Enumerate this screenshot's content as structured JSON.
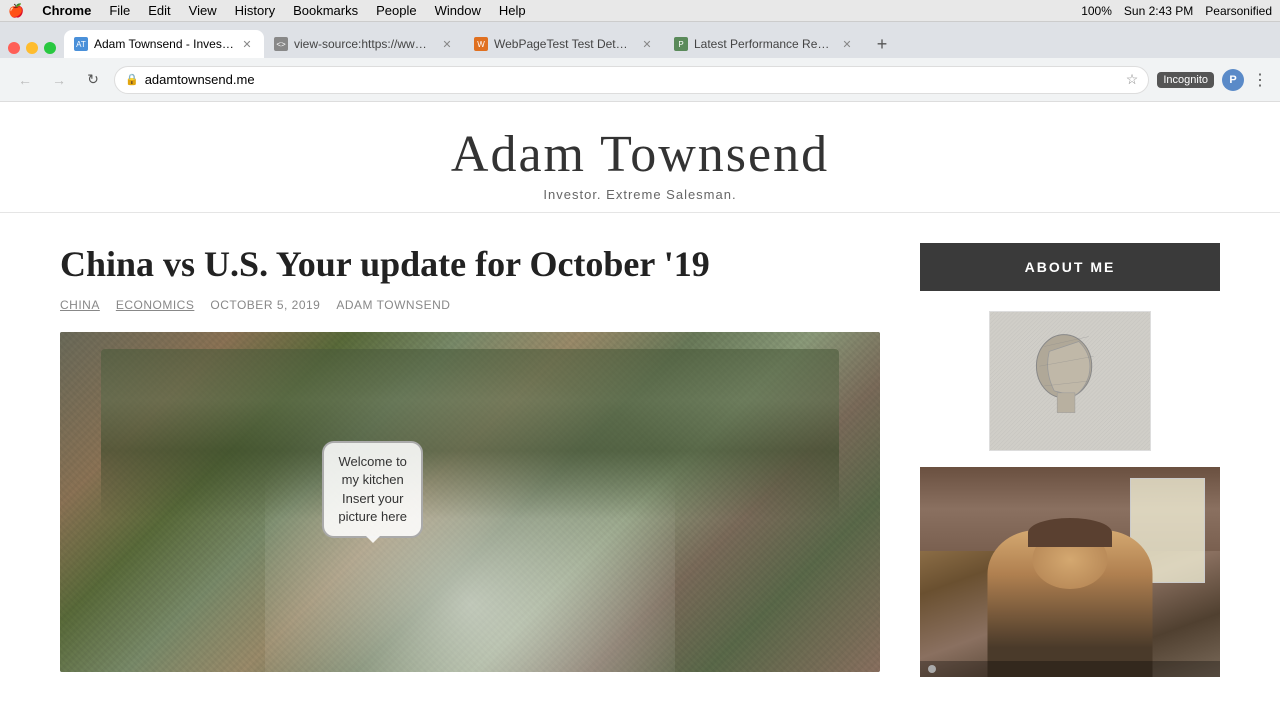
{
  "macbar": {
    "apple": "🍎",
    "menus": [
      "Chrome",
      "File",
      "Edit",
      "View",
      "History",
      "Bookmarks",
      "People",
      "Window",
      "Help"
    ],
    "time": "Sun 2:43 PM",
    "user": "Pearsonified",
    "battery": "100%"
  },
  "tabs": [
    {
      "id": "tab1",
      "label": "Adam Townsend - Investor. E...",
      "favicon": "AT",
      "active": true
    },
    {
      "id": "tab2",
      "label": "view-source:https://www.ada...",
      "favicon": "<>",
      "active": false
    },
    {
      "id": "tab3",
      "label": "WebPageTest Test Details - D...",
      "favicon": "W",
      "active": false
    },
    {
      "id": "tab4",
      "label": "Latest Performance Report fo...",
      "favicon": "P",
      "active": false
    }
  ],
  "addressbar": {
    "url": "adamtownsend.me",
    "incognito_label": "Incognito"
  },
  "site": {
    "title": "Adam Townsend",
    "tagline": "Investor. Extreme Salesman."
  },
  "post": {
    "title": "China vs U.S. Your update for October '19",
    "tags": [
      "CHINA",
      "ECONOMICS"
    ],
    "date": "OCTOBER 5, 2019",
    "author": "ADAM TOWNSEND"
  },
  "speech_bubble": {
    "line1": "Welcome to",
    "line2": "my kitchen",
    "line3": "Insert your",
    "line4": "picture here"
  },
  "sidebar": {
    "about_me_label": "ABOUT ME"
  }
}
